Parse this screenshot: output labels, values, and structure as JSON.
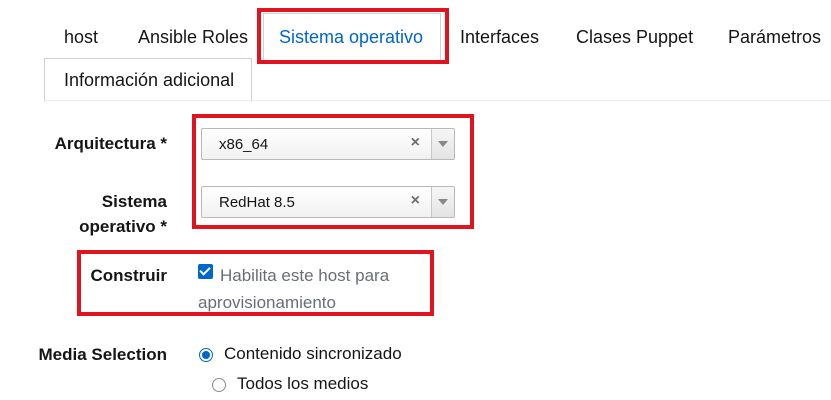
{
  "tabs": {
    "host": "host",
    "ansible_roles": "Ansible Roles",
    "sistema_operativo": "Sistema operativo",
    "interfaces": "Interfaces",
    "clases_puppet": "Clases Puppet",
    "parametros": "Parámetros",
    "informacion_adicional": "Información adicional",
    "active": "Sistema operativo"
  },
  "form": {
    "arquitectura": {
      "label": "Arquitectura *",
      "value": "x86_64",
      "clear": "×"
    },
    "sistema_operativo": {
      "label_line1": "Sistema",
      "label_line2": "operativo *",
      "value": "RedHat 8.5",
      "clear": "×"
    },
    "construir": {
      "label": "Construir",
      "checked": true,
      "text": "Habilita este host para aprovisionamiento"
    },
    "media_selection": {
      "label": "Media Selection",
      "options": [
        {
          "label": "Contenido sincronizado",
          "selected": true
        },
        {
          "label": "Todos los medios",
          "selected": false
        }
      ]
    }
  },
  "colors": {
    "accent": "#0066cc",
    "highlight": "#e0141e"
  },
  "icons": {
    "clear": "clear-icon",
    "dropdown": "caret-down-icon",
    "checkbox": "checkbox-checked"
  }
}
